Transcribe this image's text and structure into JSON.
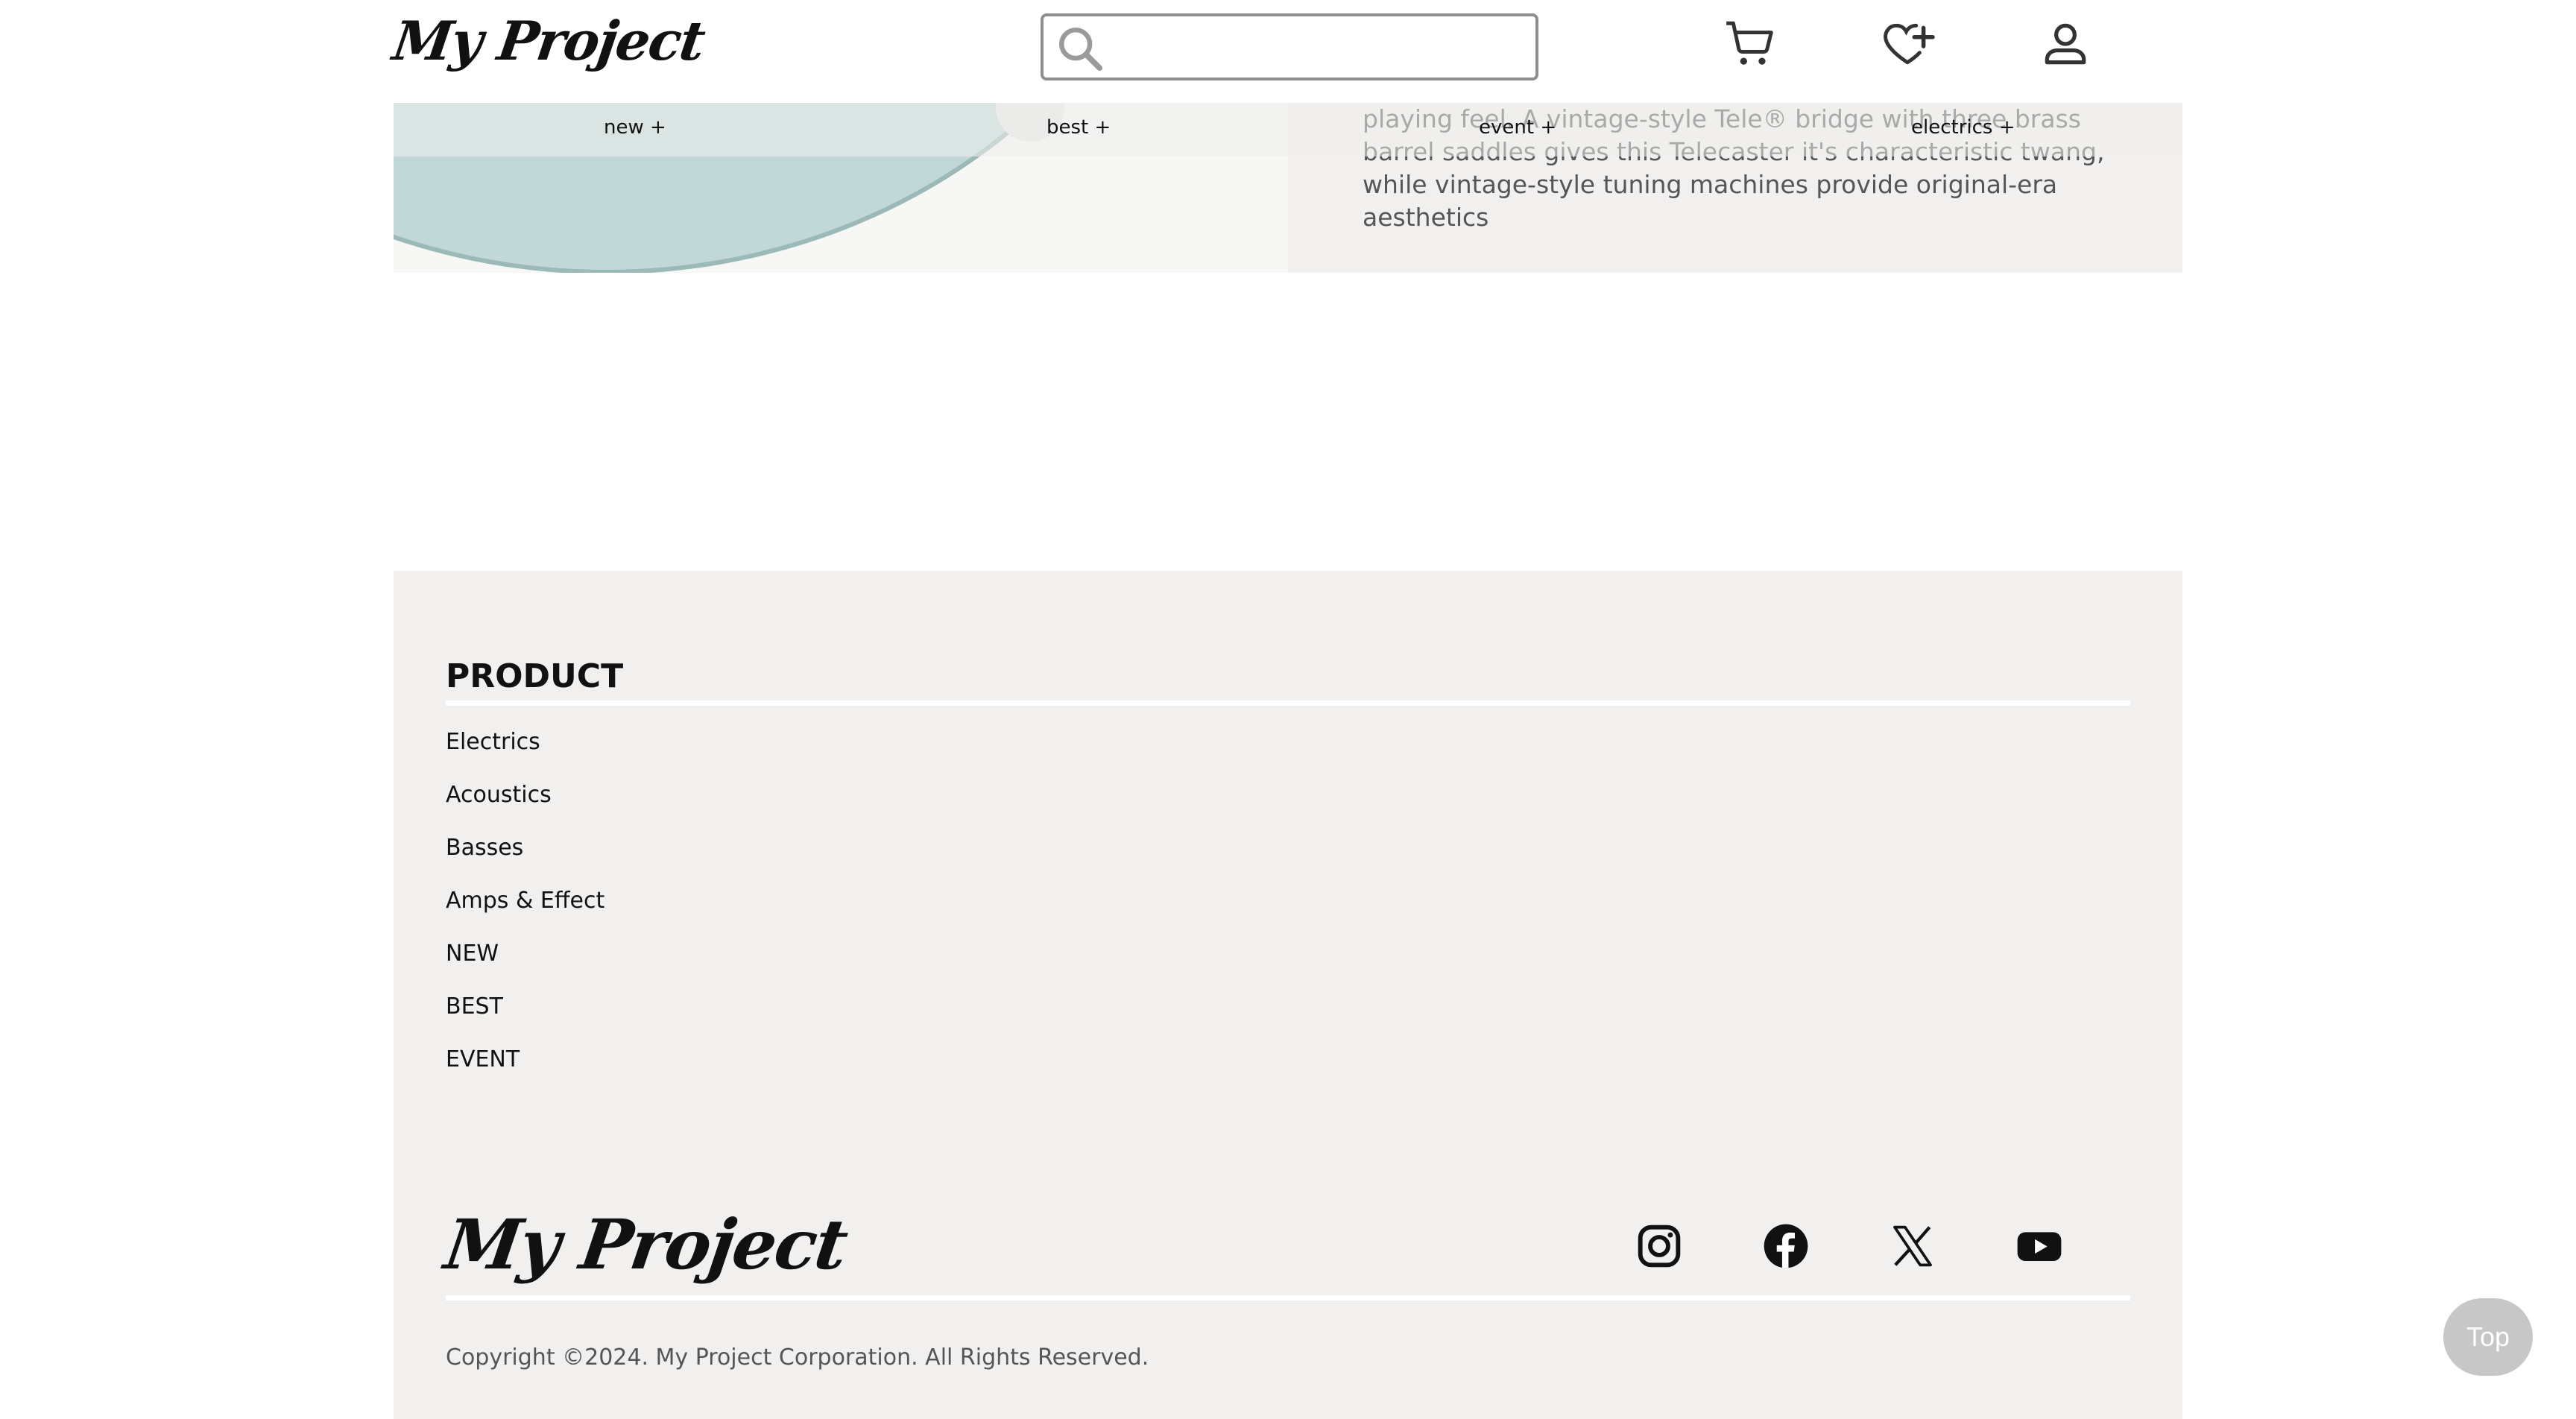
{
  "header": {
    "logo": "My Project",
    "search": {
      "placeholder": "",
      "value": ""
    },
    "icons": [
      "cart-icon",
      "wishlist-add-icon",
      "user-icon"
    ]
  },
  "nav": {
    "items": [
      {
        "label": "new +"
      },
      {
        "label": "best +"
      },
      {
        "label": "event +"
      },
      {
        "label": "electrics +"
      }
    ]
  },
  "hero": {
    "description": "playing feel. A vintage-style Tele® bridge with three brass barrel saddles gives this Telecaster it's characteristic twang, while vintage-style tuning machines provide original-era aesthetics"
  },
  "footer": {
    "product_title": "PRODUCT",
    "product_items": [
      "Electrics",
      "Acoustics",
      "Basses",
      "Amps & Effect",
      "NEW",
      "BEST",
      "EVENT"
    ],
    "logo": "My Project",
    "social_icons": [
      "instagram-icon",
      "facebook-icon",
      "x-icon",
      "youtube-icon"
    ],
    "copyright": "Copyright ©2024. My Project Corporation. All Rights Reserved."
  },
  "top_button": {
    "label": "Top"
  },
  "colors": {
    "footer_bg": "#f1f0ee",
    "top_button_bg": "#c7c7c7",
    "text": "#111111",
    "muted": "#555555"
  }
}
